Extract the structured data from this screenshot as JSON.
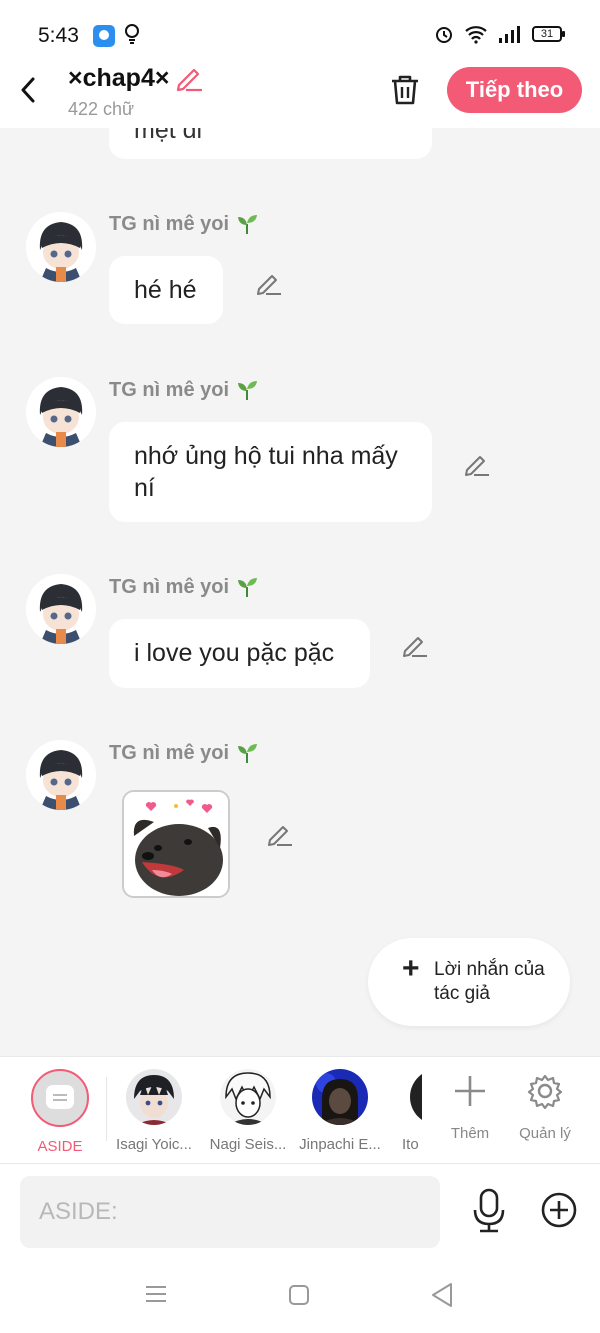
{
  "status_bar": {
    "time": "5:43",
    "battery": "31"
  },
  "header": {
    "chapter_title": "×chap4×",
    "word_count": "422 chữ",
    "next_label": "Tiếp theo"
  },
  "chat": {
    "partial_message": "mệt đi",
    "messages": [
      {
        "sender": "TG nì mê yoi",
        "text": "hé hé"
      },
      {
        "sender": "TG nì mê yoi",
        "text": "nhớ ủng hộ tui nha mấy ní"
      },
      {
        "sender": "TG nì mê yoi",
        "text": "i love you pặc pặc"
      },
      {
        "sender": "TG nì mê yoi",
        "text": ""
      }
    ],
    "sender_badge_icon": "seedling-icon",
    "sticker": "sticker-dog-hearts"
  },
  "author_note_button": {
    "label": "Lời nhắn của tác giả"
  },
  "characters": [
    {
      "name": "ASIDE",
      "active": true
    },
    {
      "name": "Isagi Yoic..."
    },
    {
      "name": "Nagi Seis..."
    },
    {
      "name": "Jinpachi E..."
    },
    {
      "name": "Ito"
    }
  ],
  "tools": {
    "add_label": "Thêm",
    "manage_label": "Quản lý"
  },
  "input": {
    "placeholder": "ASIDE:"
  },
  "colors": {
    "accent": "#f25a75",
    "background": "#f4f4f4",
    "bubble": "#ffffff"
  }
}
